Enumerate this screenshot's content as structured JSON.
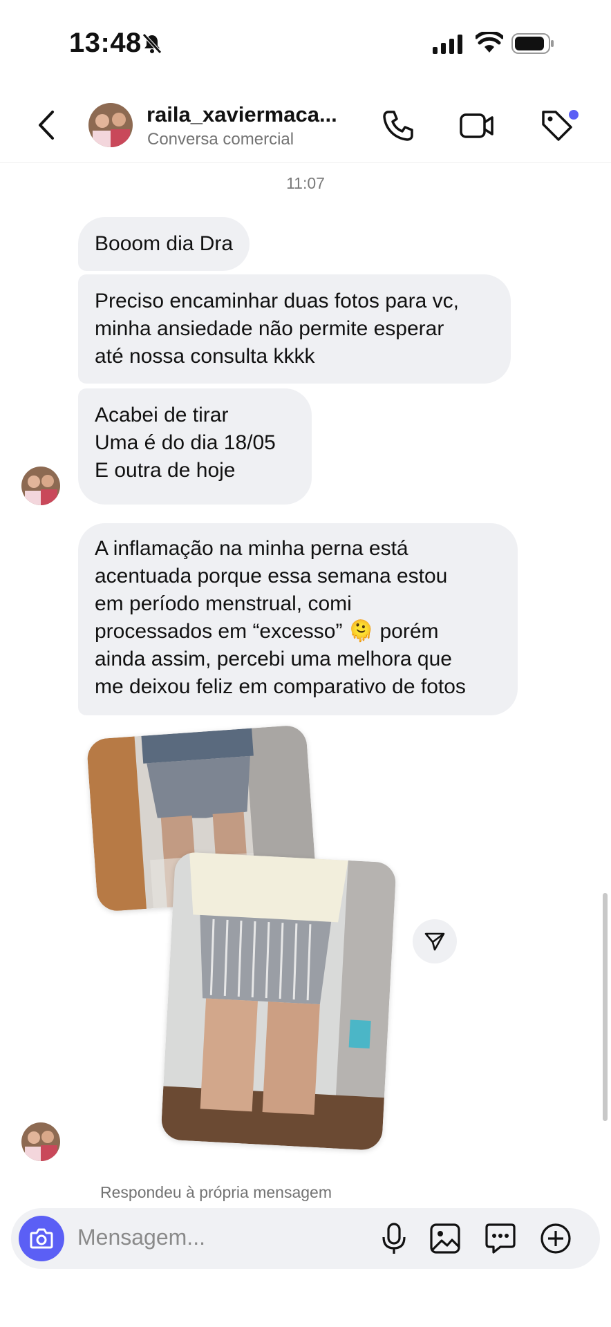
{
  "status_bar": {
    "time": "13:48"
  },
  "header": {
    "username": "raila_xaviermaca...",
    "subtitle": "Conversa comercial",
    "back_icon": "chevron-left-icon",
    "call_icon": "phone-icon",
    "video_icon": "video-camera-icon",
    "tag_icon": "tag-icon",
    "tag_badge_color": "#5b5ff5"
  },
  "conversation": {
    "timestamp": "11:07",
    "messages": [
      {
        "text": "Booom dia Dra"
      },
      {
        "text": "Preciso encaminhar duas fotos para vc,\nminha ansiedade não permite esperar\naté nossa consulta kkkk"
      },
      {
        "text": "Acabei de tirar\nUma é do dia 18/05\nE outra de hoje"
      },
      {
        "text": "A inflamação na minha perna está\nacentuada porque essa semana estou\nem período menstrual, comi\nprocessados em “excesso” 🫠 porém\nainda assim, percebi uma melhora que\nme deixou feliz em comparativo de fotos"
      }
    ],
    "photos_count": 2,
    "reply_note": "Respondeu à própria mensagem"
  },
  "composer": {
    "placeholder": "Mensagem...",
    "camera_color": "#5b5ff5"
  }
}
